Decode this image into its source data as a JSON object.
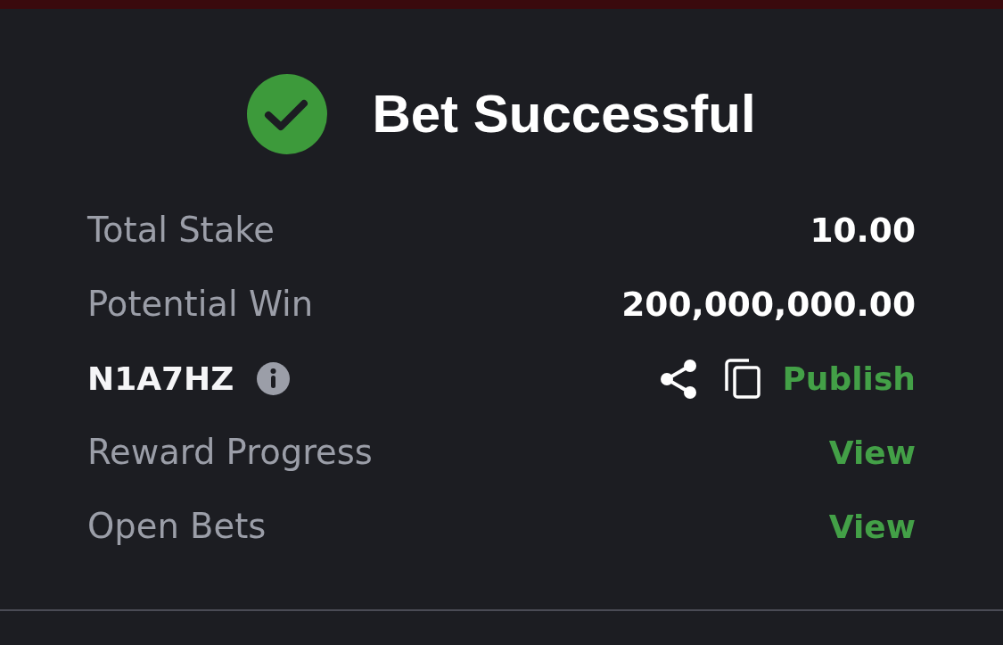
{
  "header": {
    "title": "Bet Successful"
  },
  "rows": [
    {
      "kind": "value",
      "label": "Total Stake",
      "value": "10.00"
    },
    {
      "kind": "value",
      "label": "Potential Win",
      "value": "200,000,000.00"
    },
    {
      "kind": "code",
      "code": "N1A7HZ",
      "action": "Publish"
    },
    {
      "kind": "link",
      "label": "Reward Progress",
      "action": "View"
    },
    {
      "kind": "link",
      "label": "Open Bets",
      "action": "View"
    }
  ]
}
